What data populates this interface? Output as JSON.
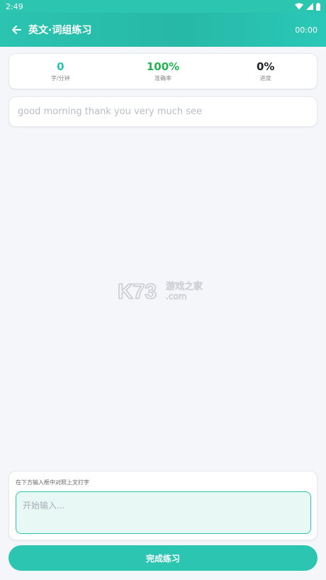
{
  "status_bar": {
    "time": "2:49"
  },
  "header": {
    "title": "英文·词组练习",
    "timer": "00:00"
  },
  "stats": [
    {
      "value": "0",
      "label": "字/分钟",
      "color": "#2cc5b0"
    },
    {
      "value": "100%",
      "label": "准确率",
      "color": "#22b455"
    },
    {
      "value": "0%",
      "label": "进度",
      "color": "#1f2329"
    }
  ],
  "target_text": "good morning thank you very much see",
  "watermark": {
    "brand": "K73",
    "tagline": "游戏之家",
    "domain": ".com"
  },
  "input": {
    "hint": "在下方输入框中对照上文打字",
    "placeholder": "开始输入..."
  },
  "finish_button": {
    "label": "完成练习"
  },
  "colors": {
    "accent": "#2cc5b0",
    "accuracy": "#22b455"
  }
}
